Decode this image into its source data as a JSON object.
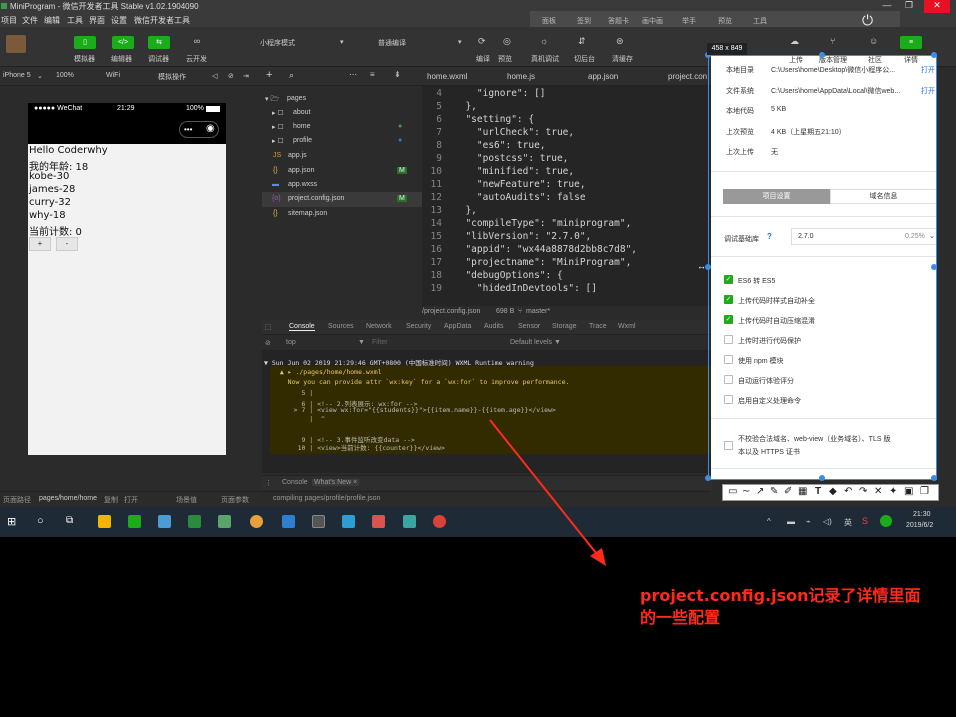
{
  "window": {
    "title": "MiniProgram - 微信开发者工具 Stable v1.02.1904090",
    "menu": [
      "项目",
      "文件",
      "编辑",
      "工具",
      "界面",
      "设置",
      "微信开发者工具"
    ]
  },
  "top_strip": [
    "面板",
    "签到",
    "答题卡",
    "画中画",
    "举手",
    "预览",
    "工具"
  ],
  "toolbar": {
    "left_buttons": [
      {
        "icon": "phone-icon",
        "label": "模拟器"
      },
      {
        "icon": "code-icon",
        "label": "编辑器"
      },
      {
        "icon": "debug-icon",
        "label": "调试器"
      },
      {
        "icon": "cloud-icon",
        "label": "云开发"
      }
    ],
    "mode_select": "小程序模式",
    "compile_select": "普通编译",
    "right_labels": [
      "编译",
      "预览",
      "真机调试",
      "切后台",
      "清缓存"
    ],
    "panel_labels": [
      "上传",
      "版本管理",
      "社区",
      "详情"
    ]
  },
  "simulator_bar": {
    "device": "iPhone 5",
    "zoom": "100%",
    "network": "WiFi",
    "action": "模拟操作"
  },
  "phone": {
    "carrier": "●●●●● WeChat",
    "time": "21:29",
    "battery": "100%",
    "lines": [
      "Hello Coderwhy",
      "我的年龄: 18",
      "kobe-30",
      "james-28",
      "curry-32",
      "why-18",
      "当前计数: 0"
    ],
    "buttons": [
      "+",
      "-"
    ]
  },
  "file_tree": {
    "items": [
      {
        "icon": "folder-open-icon",
        "label": "pages",
        "badge": ""
      },
      {
        "icon": "folder-icon",
        "label": "about",
        "badge": ""
      },
      {
        "icon": "folder-icon",
        "label": "home",
        "badge": "●"
      },
      {
        "icon": "folder-icon",
        "label": "profile",
        "badge": "●"
      },
      {
        "icon": "js-icon",
        "label": "app.js",
        "badge": ""
      },
      {
        "icon": "json-icon",
        "label": "app.json",
        "badge": "M"
      },
      {
        "icon": "wxss-icon",
        "label": "app.wxss",
        "badge": ""
      },
      {
        "icon": "config-icon",
        "label": "project.config.json",
        "badge": "M"
      },
      {
        "icon": "json-icon",
        "label": "sitemap.json",
        "badge": ""
      }
    ]
  },
  "editor": {
    "tabs": [
      "home.wxml",
      "home.js",
      "app.json",
      "project.con"
    ],
    "lines": [
      {
        "n": "4",
        "text": "    \"ignore\": []"
      },
      {
        "n": "5",
        "text": "  },"
      },
      {
        "n": "6",
        "text": "  \"setting\": {"
      },
      {
        "n": "7",
        "text": "    \"urlCheck\": true,"
      },
      {
        "n": "8",
        "text": "    \"es6\": true,"
      },
      {
        "n": "9",
        "text": "    \"postcss\": true,"
      },
      {
        "n": "10",
        "text": "    \"minified\": true,"
      },
      {
        "n": "11",
        "text": "    \"newFeature\": true,"
      },
      {
        "n": "12",
        "text": "    \"autoAudits\": false"
      },
      {
        "n": "13",
        "text": "  },"
      },
      {
        "n": "14",
        "text": "  \"compileType\": \"miniprogram\","
      },
      {
        "n": "15",
        "text": "  \"libVersion\": \"2.7.0\","
      },
      {
        "n": "16",
        "text": "  \"appid\": \"wx44a8878d2bb8c7d8\","
      },
      {
        "n": "17",
        "text": "  \"projectname\": \"MiniProgram\","
      },
      {
        "n": "18",
        "text": "  \"debugOptions\": {"
      },
      {
        "n": "19",
        "text": "    \"hidedInDevtools\": []"
      }
    ],
    "status_path": "/project.config.json",
    "status_size": "698 B",
    "status_branch": "master*"
  },
  "console": {
    "tabs": [
      "Console",
      "Sources",
      "Network",
      "Security",
      "AppData",
      "Audits",
      "Sensor",
      "Storage",
      "Trace",
      "Wxml"
    ],
    "filter_top": "top",
    "filter_placeholder": "Filter",
    "levels": "Default levels ▼",
    "lines": [
      "▼ Sun Jun 02 2019 21:29:46 GMT+0800 (中国标准时间) WXML Runtime warning",
      "  ▲ ▸ ./pages/home/home.wxml",
      "    Now you can provide attr `wx:key` for a `wx:for` to improve performance.",
      "      5 |",
      "      6 | <!-- 2.列表展示: wx:for -->",
      "    > 7 | <view wx:for=\"{{students}}\">{{item.name}}-{{item.age}}</view>",
      "        |  ^",
      "      9 | <!-- 3.事件监听改变data -->",
      "     10 | <view>当前计数: {{counter}}</view>"
    ],
    "bottom_tabs": [
      "Console",
      "What's New ×"
    ]
  },
  "statusbar": {
    "path_label": "页面路径",
    "path": "pages/home/home",
    "copy": "复制",
    "open": "打开",
    "scene": "场景值",
    "params": "页面参数",
    "compiling": "compiling pages/profile/profile.json"
  },
  "details": {
    "info_rows": [
      {
        "label": "本地目录",
        "value": "C:\\Users\\home\\Desktop\\微信小程序公...",
        "link": "打开"
      },
      {
        "label": "文件系统",
        "value": "C:\\Users\\home\\AppData\\Local\\微信web...",
        "link": "打开"
      },
      {
        "label": "本地代码",
        "value": "5 KB",
        "link": ""
      },
      {
        "label": "上次预览",
        "value": "4 KB（上星期五21:10）",
        "link": ""
      },
      {
        "label": "上次上传",
        "value": "无",
        "link": ""
      }
    ],
    "tab_active": "项目设置",
    "tab_other": "域名信息",
    "lib_label": "调试基础库",
    "lib_version": "2.7.0",
    "lib_percent": "0.25%",
    "options": [
      {
        "label": "ES6 转 ES5",
        "checked": true
      },
      {
        "label": "上传代码时样式自动补全",
        "checked": true
      },
      {
        "label": "上传代码时自动压缩混淆",
        "checked": true
      },
      {
        "label": "上传时进行代码保护",
        "checked": false
      },
      {
        "label": "使用 npm 模块",
        "checked": false
      },
      {
        "label": "自动运行体验评分",
        "checked": false
      },
      {
        "label": "启用自定义处理命令",
        "checked": false
      }
    ],
    "domain_check_line1": "不校验合法域名、web-view（业务域名）、TLS 版",
    "domain_check_line2": "本以及 HTTPS 证书"
  },
  "capture": {
    "size": "458 x 849"
  },
  "taskbar": {
    "time": "21:30",
    "date": "2019/6/2",
    "lang": "英"
  },
  "annotation": {
    "line1": "project.config.json记录了详情里面",
    "line2": "的一些配置",
    "color": "#ff2a1a"
  }
}
